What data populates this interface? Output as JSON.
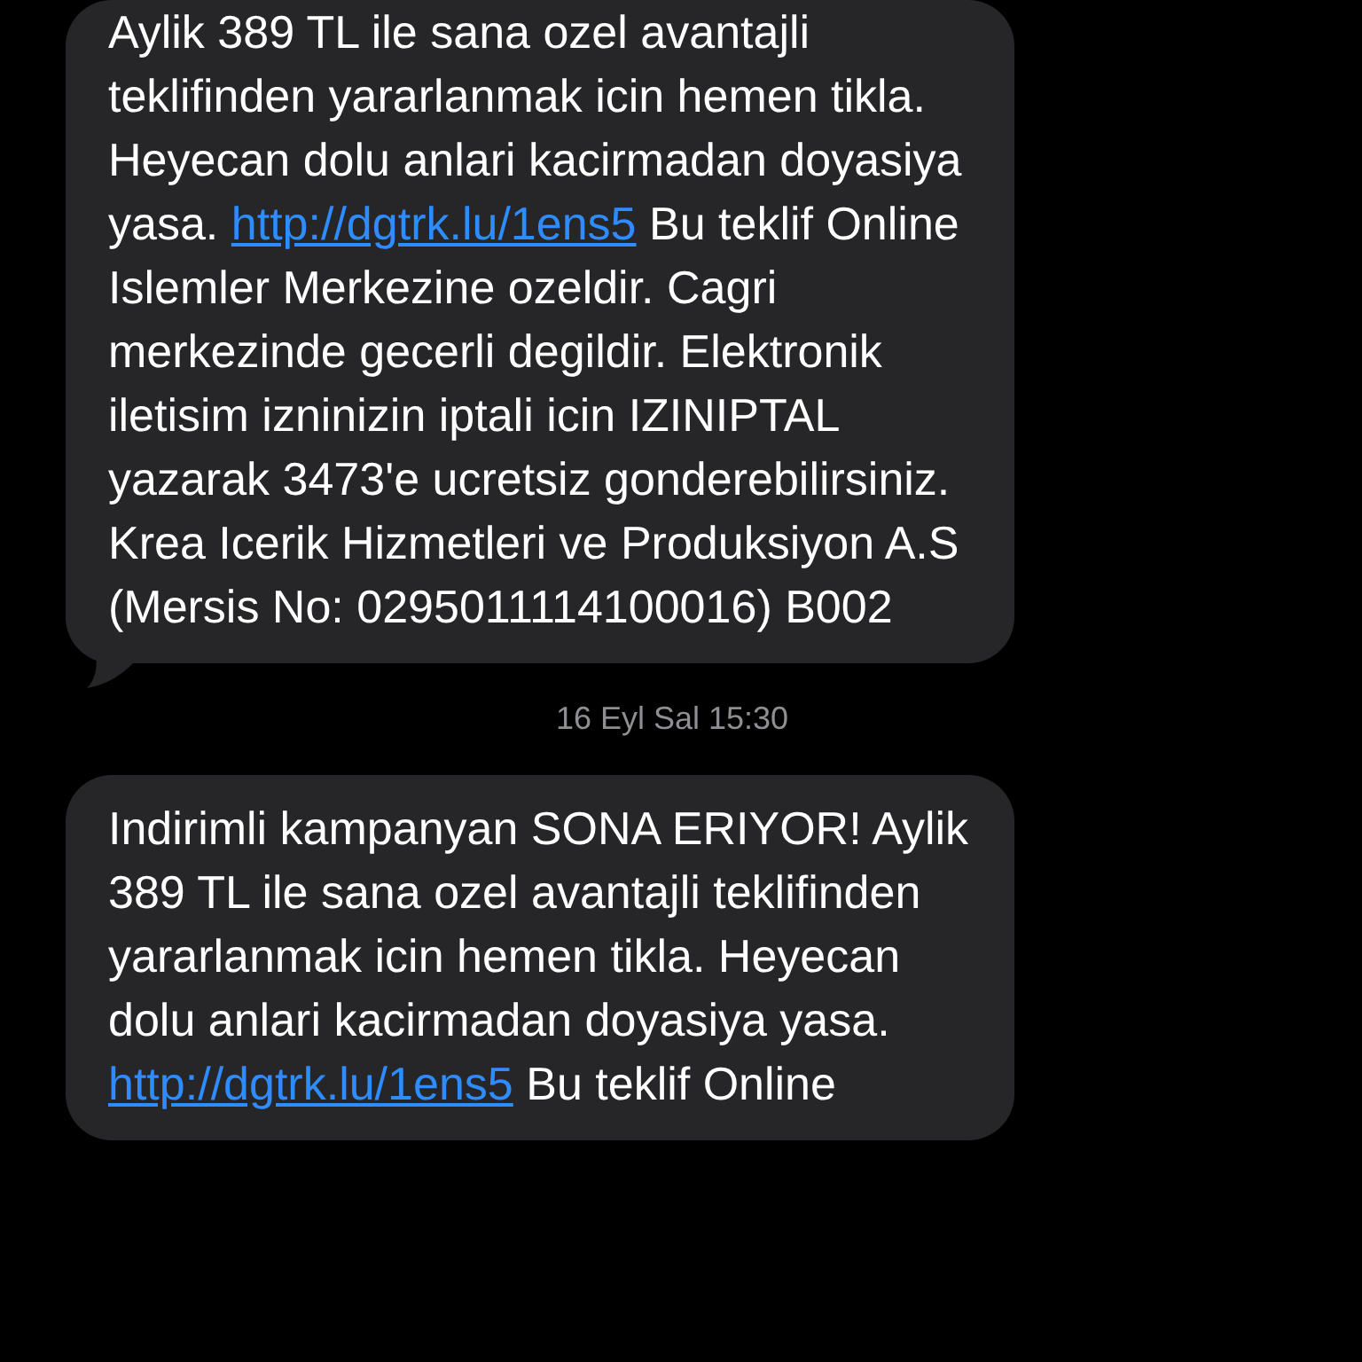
{
  "messages": [
    {
      "before": "Aylik 389 TL ile sana ozel avantajli teklifinden yararlanmak icin hemen tikla. Heyecan dolu anlari kacirmadan doyasiya yasa.",
      "link": "http://dgtrk.lu/1ens5",
      "after": "Bu teklif Online Islemler Merkezine ozeldir. Cagri merkezinde gecerli degildir. Elektronik iletisim izninizin iptali icin IZINIPTAL yazarak 3473'e ucretsiz gonderebilirsiniz. Krea Icerik Hizmetleri ve Produksiyon A.S (Mersis No: 0295011114100016) B002",
      "tail": true
    },
    {
      "timestamp": "16 Eyl Sal 15:30",
      "before": "Indirimli kampanyan SONA ERIYOR! Aylik 389 TL ile sana ozel avantajli teklifinden yararlanmak icin hemen tikla. Heyecan dolu anlari kacirmadan doyasiya yasa.",
      "link": "http://dgtrk.lu/1ens5",
      "after": "Bu teklif Online",
      "tail": false
    }
  ]
}
